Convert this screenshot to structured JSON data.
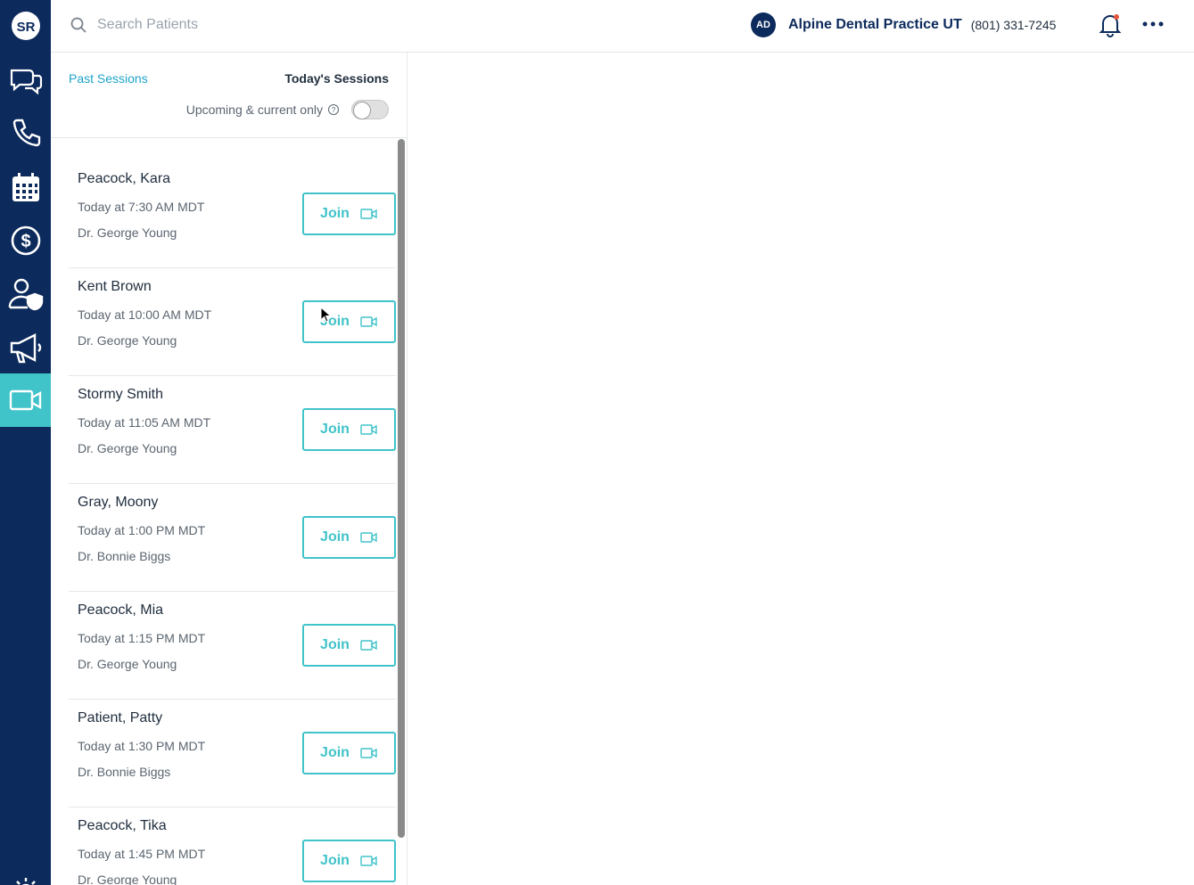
{
  "app": {
    "logo_text": "SR"
  },
  "header": {
    "search_placeholder": "Search Patients",
    "avatar_initials": "AD",
    "practice_name": "Alpine Dental Practice UT",
    "practice_phone": "(801) 331-7245"
  },
  "nav": {
    "items": [
      "chat-icon",
      "phone-icon",
      "calendar-icon",
      "dollar-icon",
      "user-shield-icon",
      "megaphone-icon",
      "video-icon",
      "gear-icon"
    ],
    "active": "video-icon"
  },
  "panel": {
    "past_tab": "Past Sessions",
    "today_tab": "Today's Sessions",
    "filter_label": "Upcoming & current only",
    "filter_enabled": false,
    "help_glyph": "?"
  },
  "sessions": [
    {
      "name": "Peacock, Kara",
      "time": "Today at 7:30 AM MDT",
      "doctor": "Dr. George Young",
      "action": "Join"
    },
    {
      "name": "Kent Brown",
      "time": "Today at 10:00 AM MDT",
      "doctor": "Dr. George Young",
      "action": "Join"
    },
    {
      "name": "Stormy Smith",
      "time": "Today at 11:05 AM MDT",
      "doctor": "Dr. George Young",
      "action": "Join"
    },
    {
      "name": "Gray, Moony",
      "time": "Today at 1:00 PM MDT",
      "doctor": "Dr. Bonnie Biggs",
      "action": "Join"
    },
    {
      "name": "Peacock, Mia",
      "time": "Today at 1:15 PM MDT",
      "doctor": "Dr. George Young",
      "action": "Join"
    },
    {
      "name": "Patient, Patty",
      "time": "Today at 1:30 PM MDT",
      "doctor": "Dr. Bonnie Biggs",
      "action": "Join"
    },
    {
      "name": "Peacock, Tika",
      "time": "Today at 1:45 PM MDT",
      "doctor": "Dr. George Young",
      "action": "Join"
    }
  ],
  "colors": {
    "nav_bg": "#0c2a5c",
    "accent": "#40c3c9",
    "link": "#1fa4c8"
  }
}
